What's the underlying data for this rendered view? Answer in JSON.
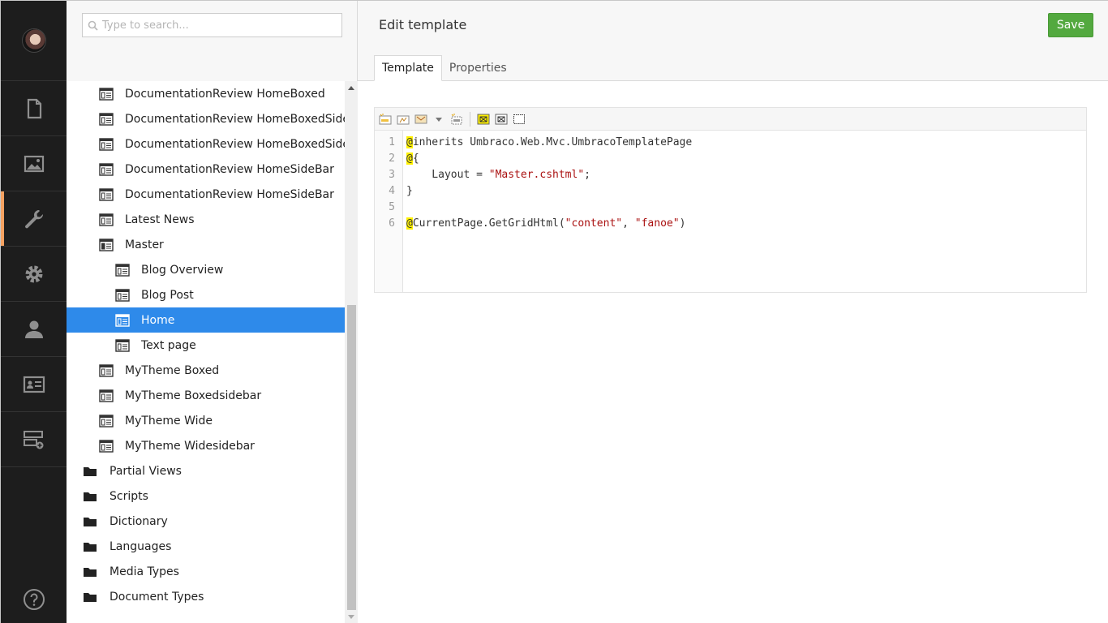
{
  "search": {
    "placeholder": "Type to search..."
  },
  "sections": [
    "content-icon",
    "media-icon",
    "settings-wrench-icon",
    "developer-gear-icon",
    "users-icon",
    "members-icon",
    "forms-icon"
  ],
  "active_section": "settings-wrench-icon",
  "tree": {
    "items": [
      {
        "label": "DocumentationReview HomeBoxed",
        "level": 1,
        "type": "template"
      },
      {
        "label": "DocumentationReview HomeBoxedSideBar",
        "level": 1,
        "type": "template"
      },
      {
        "label": "DocumentationReview HomeBoxedSideBar",
        "level": 1,
        "type": "template"
      },
      {
        "label": "DocumentationReview HomeSideBar",
        "level": 1,
        "type": "template"
      },
      {
        "label": "DocumentationReview HomeSideBar",
        "level": 1,
        "type": "template"
      },
      {
        "label": "Latest News",
        "level": 1,
        "type": "template"
      },
      {
        "label": "Master",
        "level": 1,
        "type": "template-open"
      },
      {
        "label": "Blog Overview",
        "level": 2,
        "type": "template"
      },
      {
        "label": "Blog Post",
        "level": 2,
        "type": "template"
      },
      {
        "label": "Home",
        "level": 2,
        "type": "template",
        "selected": true
      },
      {
        "label": "Text page",
        "level": 2,
        "type": "template"
      },
      {
        "label": "MyTheme Boxed",
        "level": 1,
        "type": "template"
      },
      {
        "label": "MyTheme Boxedsidebar",
        "level": 1,
        "type": "template"
      },
      {
        "label": "MyTheme Wide",
        "level": 1,
        "type": "template"
      },
      {
        "label": "MyTheme Widesidebar",
        "level": 1,
        "type": "template"
      },
      {
        "label": "Partial Views",
        "level": 0,
        "type": "folder"
      },
      {
        "label": "Scripts",
        "level": 0,
        "type": "folder"
      },
      {
        "label": "Dictionary",
        "level": 0,
        "type": "folder"
      },
      {
        "label": "Languages",
        "level": 0,
        "type": "folder"
      },
      {
        "label": "Media Types",
        "level": 0,
        "type": "folder"
      },
      {
        "label": "Document Types",
        "level": 0,
        "type": "folder"
      }
    ]
  },
  "header": {
    "title": "Edit template",
    "save_label": "Save",
    "tabs": [
      {
        "label": "Template",
        "active": true
      },
      {
        "label": "Properties",
        "active": false
      }
    ]
  },
  "editor": {
    "line_numbers": [
      "1",
      "2",
      "3",
      "4",
      "5",
      "6"
    ],
    "lines": [
      [
        {
          "t": "@",
          "c": "at"
        },
        {
          "t": "inherits Umbraco.Web.Mvc.UmbracoTemplatePage",
          "c": ""
        }
      ],
      [
        {
          "t": "@",
          "c": "at"
        },
        {
          "t": "{",
          "c": ""
        }
      ],
      [
        {
          "t": "    Layout = ",
          "c": ""
        },
        {
          "t": "\"Master.cshtml\"",
          "c": "str"
        },
        {
          "t": ";",
          "c": ""
        }
      ],
      [
        {
          "t": "}",
          "c": ""
        }
      ],
      [],
      [
        {
          "t": "@",
          "c": "at"
        },
        {
          "t": "CurrentPage.GetGridHtml(",
          "c": ""
        },
        {
          "t": "\"content\"",
          "c": "str"
        },
        {
          "t": ", ",
          "c": ""
        },
        {
          "t": "\"fanoe\"",
          "c": "str"
        },
        {
          "t": ")",
          "c": ""
        }
      ]
    ]
  },
  "colors": {
    "accent_blue": "#2e8aea",
    "save_green": "#53a93f",
    "section_active": "#f5a262",
    "sections_bg": "#1d1d1d"
  }
}
